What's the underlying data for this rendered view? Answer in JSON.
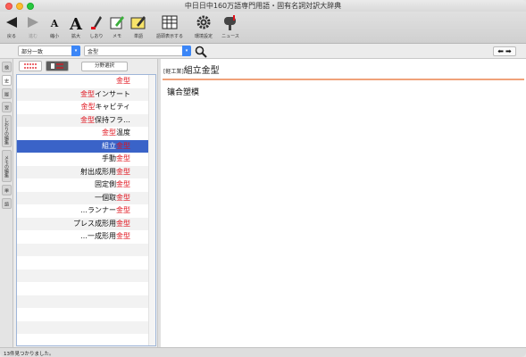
{
  "window": {
    "title": "中日日中160万語専門用語・固有名詞対訳大辞典"
  },
  "toolbar": {
    "back_label": "戻る",
    "forward_label": "進む",
    "shrink_label": "縮小",
    "enlarge_label": "拡大",
    "bookmark_label": "しおり",
    "memo_label": "メモ",
    "wordbook_label": "単語",
    "show_words_label": "語頭表示する",
    "settings_label": "環境設定",
    "news_label": "ニュース"
  },
  "search": {
    "mode_value": "部分一致",
    "query_value": "金型"
  },
  "side_tabs": [
    "検",
    "史",
    "履",
    "習",
    "しおりの編集",
    "メモの編集",
    "単",
    "語"
  ],
  "list": {
    "field_select_label": "分野選択",
    "rows": [
      {
        "prefix": "",
        "match": "金型",
        "suffix": ""
      },
      {
        "prefix": "",
        "match": "金型",
        "suffix": "インサート"
      },
      {
        "prefix": "",
        "match": "金型",
        "suffix": "キャビティ"
      },
      {
        "prefix": "",
        "match": "金型",
        "suffix": "保持フラ…"
      },
      {
        "prefix": "",
        "match": "金型",
        "suffix": "温度"
      },
      {
        "prefix": "組立",
        "match": "金型",
        "suffix": ""
      },
      {
        "prefix": "手動",
        "match": "金型",
        "suffix": ""
      },
      {
        "prefix": "射出成形用",
        "match": "金型",
        "suffix": ""
      },
      {
        "prefix": "固定側",
        "match": "金型",
        "suffix": ""
      },
      {
        "prefix": "一個取",
        "match": "金型",
        "suffix": ""
      },
      {
        "prefix": "…ランナー",
        "match": "金型",
        "suffix": ""
      },
      {
        "prefix": "プレス成形用",
        "match": "金型",
        "suffix": ""
      },
      {
        "prefix": "…一成形用",
        "match": "金型",
        "suffix": ""
      }
    ],
    "selected_index": 5
  },
  "entry": {
    "field_tag": "[軽工業]",
    "headword": "組立金型",
    "translation": "镶合塑模"
  },
  "status": {
    "text": "13件見つかりました。"
  },
  "colors": {
    "selection": "#3a63c8",
    "highlight": "#e0101a",
    "entry_rule": "#f0a27a"
  }
}
